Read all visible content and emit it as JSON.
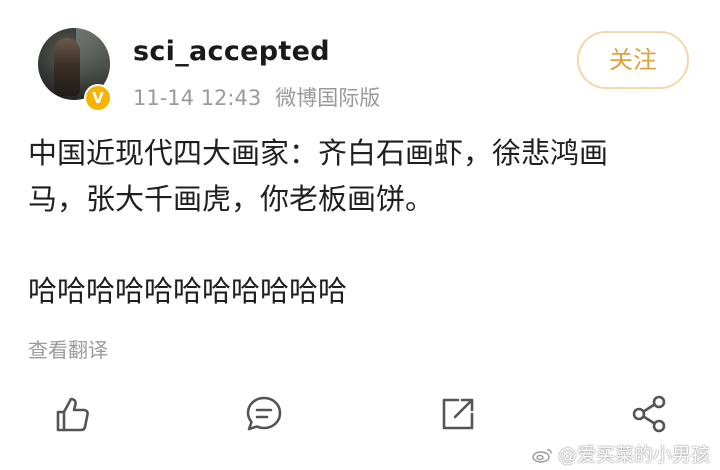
{
  "post": {
    "username": "sci_accepted",
    "timestamp": "11-14 12:43",
    "source": "微博国际版",
    "follow_label": "关注",
    "text_line1": "中国近现代四大画家：齐白石画虾，徐悲鸿画",
    "text_line2": "马，张大千画虎，你老板画饼。",
    "text_line3": "哈哈哈哈哈哈哈哈哈哈哈",
    "translate_label": "查看翻译"
  },
  "actions": [
    {
      "icon": "thumbs-up-icon"
    },
    {
      "icon": "comment-icon"
    },
    {
      "icon": "repost-icon"
    },
    {
      "icon": "share-icon"
    }
  ],
  "watermark": {
    "text": "@爱买菜的小男孩"
  },
  "colors": {
    "follow_text": "#e0a03a",
    "follow_border": "#f3d8a8",
    "verify_badge": "#f5b400",
    "meta_text": "#9a9a9a"
  }
}
